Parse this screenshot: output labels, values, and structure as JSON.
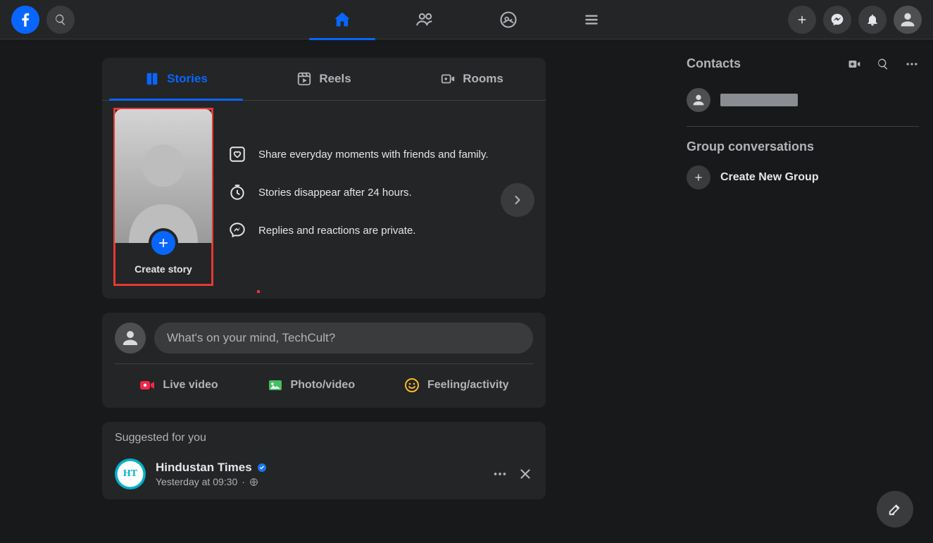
{
  "tabs": {
    "stories": "Stories",
    "reels": "Reels",
    "rooms": "Rooms"
  },
  "story_tile": {
    "label": "Create story"
  },
  "story_info": {
    "line1": "Share everyday moments with friends and family.",
    "line2": "Stories disappear after 24 hours.",
    "line3": "Replies and reactions are private."
  },
  "composer": {
    "placeholder": "What's on your mind, TechCult?",
    "live_video": "Live video",
    "photo_video": "Photo/video",
    "feeling": "Feeling/activity"
  },
  "suggested": {
    "heading": "Suggested for you",
    "page_name": "Hindustan Times",
    "timestamp": "Yesterday at 09:30",
    "avatar_text": "HT"
  },
  "right": {
    "contacts": "Contacts",
    "group_header": "Group conversations",
    "create_group": "Create New Group"
  }
}
